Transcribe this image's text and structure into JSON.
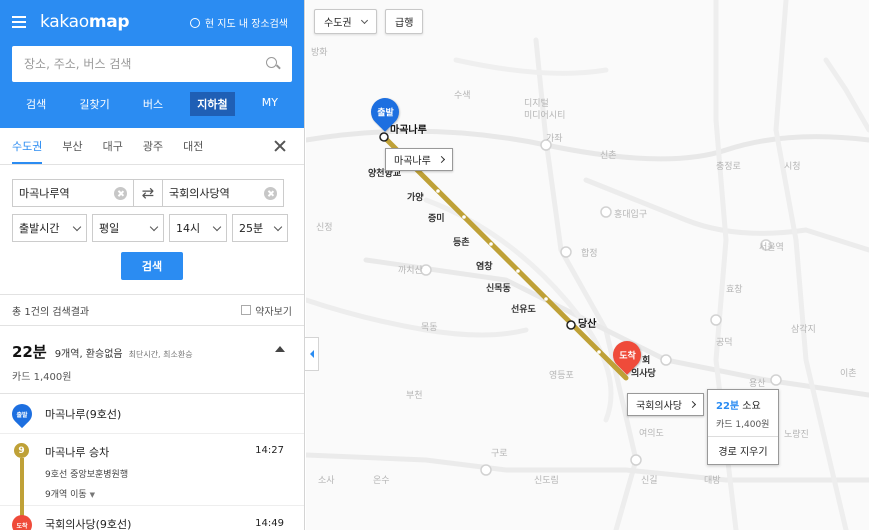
{
  "header": {
    "logo_light": "kakao",
    "logo_bold": "map",
    "nearby_search": "현 지도 내 장소검색"
  },
  "search": {
    "placeholder": "장소, 주소, 버스 검색"
  },
  "main_tabs": [
    "검색",
    "길찾기",
    "버스",
    "지하철",
    "MY"
  ],
  "active_main_tab": "지하철",
  "region_tabs": [
    "수도권",
    "부산",
    "대구",
    "광주",
    "대전"
  ],
  "active_region_tab": "수도권",
  "origin": "마곡나루역",
  "destination": "국회의사당역",
  "options": {
    "time_type": "출발시간",
    "day_type": "평일",
    "hour": "14시",
    "minute": "25분"
  },
  "search_button": "검색",
  "result_count": "총 1건의 검색결과",
  "legend_toggle": "약자보기",
  "route": {
    "total_time": "22분",
    "info": "9개역, 환승없음",
    "tags": "최단시간, 최소환승",
    "fare": "카드 1,400원",
    "steps": {
      "start_badge": "출발",
      "start_station": "마곡나루(9호선)",
      "line_number": "9",
      "board_title": "마곡나루 승차",
      "board_time": "14:27",
      "board_line": "9호선 중앙보훈병원행",
      "move_text": "9개역 이동",
      "end_badge": "도착",
      "end_station": "국회의사당(9호선)",
      "end_time": "14:49"
    }
  },
  "map": {
    "region_select": "수도권",
    "express_button": "급행",
    "start_pin": "출발",
    "end_pin": "도착",
    "start_callout": "마곡나루",
    "end_callout": "국회의사당",
    "popup_time": "22분",
    "popup_time_suffix": " 소요",
    "popup_fare": "카드 1,400원",
    "popup_clear": "경로 지우기",
    "station_labels": {
      "magoknaru": "마곡나루",
      "yangcheon_hyanggyo": "양천향교",
      "gayang": "가양",
      "jeungmi": "증미",
      "deungchon": "등촌",
      "yeomchang": "염창",
      "sinmokdong": "신목동",
      "seonyudo": "선유도",
      "dangsan": "당산",
      "nat_assembly_line1": "회",
      "nat_assembly_line2": "의사당"
    },
    "background_labels": {
      "banghwa": "방화",
      "mapo": "수색",
      "digital": "디지털",
      "dmc": "미디어시티",
      "gajwa": "가좌",
      "sinchon": "신촌",
      "hongdae": "홍대입구",
      "hapjeong": "합정",
      "seoul_station": "서울역",
      "gongdeok": "공덕",
      "hyochang": "효창",
      "sinjeong": "신정",
      "mokdong": "목동",
      "yeouido": "여의도",
      "yeongdeungpo": "영등포",
      "singil": "신길",
      "daebang": "대방",
      "noryangjin": "노량진",
      "sindorim": "신도림",
      "guro": "구로",
      "bucheon": "부천",
      "gimpo": "까치산",
      "sosa": "소사",
      "onsu": "온수",
      "samgakji": "삼각지",
      "yongsan": "용산",
      "ichon": "이촌",
      "chungjeongno": "충정로",
      "sicheong": "시청"
    },
    "colors": {
      "line9": "#bfa137",
      "start_pin": "#1d6fe0",
      "end_pin": "#ef4b3a",
      "accent": "#2b8cf2"
    }
  }
}
